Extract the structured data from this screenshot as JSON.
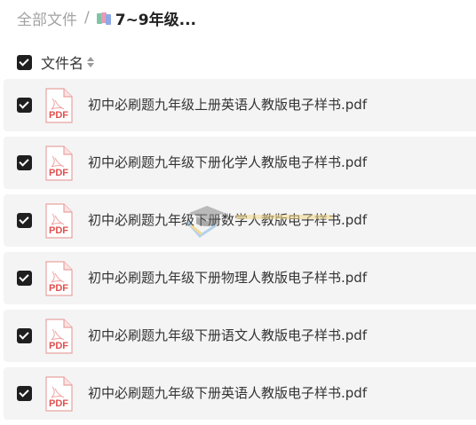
{
  "breadcrumb": {
    "root": "全部文件",
    "separator": "/",
    "current": "7~9年级..."
  },
  "header": {
    "name_label": "文件名",
    "select_all_checked": true
  },
  "icons": {
    "folder": "books-folder-icon",
    "file": "pdf-file-icon",
    "sort": "sort-updown-icon"
  },
  "colors": {
    "checkbox": "#1f1f1f",
    "row_background": "#f4f4f5",
    "pdf_red": "#e0504d"
  },
  "files": [
    {
      "name": "初中必刷题九年级上册英语人教版电子样书.pdf",
      "type_label": "PDF",
      "checked": true
    },
    {
      "name": "初中必刷题九年级下册化学人教版电子样书.pdf",
      "type_label": "PDF",
      "checked": true
    },
    {
      "name": "初中必刷题九年级下册数学人教版电子样书.pdf",
      "type_label": "PDF",
      "checked": true
    },
    {
      "name": "初中必刷题九年级下册物理人教版电子样书.pdf",
      "type_label": "PDF",
      "checked": true
    },
    {
      "name": "初中必刷题九年级下册语文人教版电子样书.pdf",
      "type_label": "PDF",
      "checked": true
    },
    {
      "name": "初中必刷题九年级下册英语人教版电子样书.pdf",
      "type_label": "PDF",
      "checked": true
    }
  ]
}
